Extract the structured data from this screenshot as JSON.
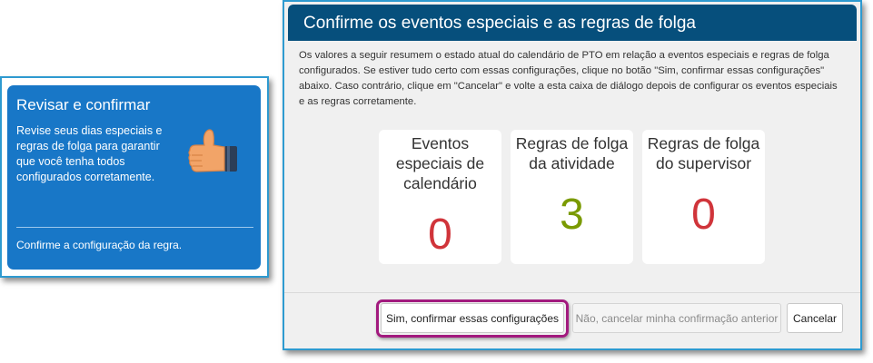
{
  "left_card": {
    "title": "Revisar e confirmar",
    "description": "Revise seus dias especiais e regras de folga para garantir que você tenha todos configurados corretamente.",
    "link": "Confirme a configuração da regra."
  },
  "dialog": {
    "title": "Confirme os eventos especiais e as regras de folga",
    "body": "Os valores a seguir resumem o estado atual do calendário de PTO em relação a eventos especiais e regras de folga configurados. Se estiver tudo certo com essas configurações, clique no botão \"Sim, confirmar essas configurações\" abaixo. Caso contrário, clique em \"Cancelar\" e volte a esta caixa de diálogo depois de configurar os eventos especiais e as regras corretamente.",
    "tiles": [
      {
        "label": "Eventos especiais de calendário",
        "value": "0",
        "color": "#d0343a"
      },
      {
        "label": "Regras de folga da atividade",
        "value": "3",
        "color": "#7a9a01"
      },
      {
        "label": "Regras de folga do supervisor",
        "value": "0",
        "color": "#d0343a"
      }
    ],
    "buttons": {
      "confirm": "Sim, confirmar essas configurações",
      "revoke": "Não, cancelar minha confirmação anterior",
      "cancel": "Cancelar"
    }
  },
  "colors": {
    "header_bg": "#064f7c",
    "card_bg": "#1877c7",
    "frame_border": "#2e9ad0",
    "highlight": "#a21a7e"
  },
  "icons": {
    "thumb": "thumbs-up-icon"
  }
}
